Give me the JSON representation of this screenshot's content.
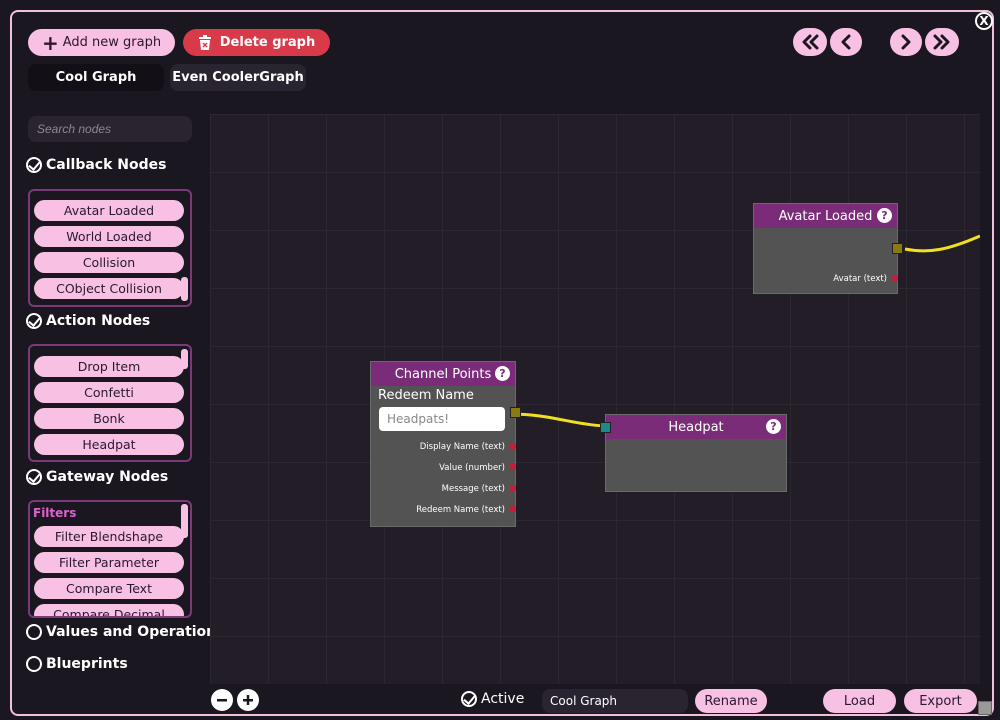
{
  "toolbar": {
    "add_label": "Add new graph",
    "delete_label": "Delete graph"
  },
  "tabs": [
    {
      "label": "Cool Graph"
    },
    {
      "label": "Even CoolerGraph"
    }
  ],
  "window": {
    "close_label": "X"
  },
  "sidebar": {
    "search_placeholder": "Search nodes",
    "callback": {
      "title": "Callback Nodes",
      "items": [
        "Avatar Loaded",
        "World Loaded",
        "Collision",
        "CObject Collision"
      ]
    },
    "action": {
      "title": "Action Nodes",
      "items": [
        "Drop Item",
        "Confetti",
        "Bonk",
        "Headpat"
      ]
    },
    "gateway": {
      "title": "Gateway Nodes",
      "group_label": "Filters",
      "items": [
        "Filter Blendshape",
        "Filter Parameter",
        "Compare Text",
        "Compare Decimal"
      ]
    },
    "values": {
      "title": "Values and Operations"
    },
    "blueprints": {
      "title": "Blueprints"
    }
  },
  "nodes": {
    "avatar_loaded": {
      "title": "Avatar Loaded",
      "output": "Avatar (text)"
    },
    "channel_points": {
      "title": "Channel Points",
      "field_label": "Redeem Name",
      "field_value": "Headpats!",
      "outputs": [
        "Display Name (text)",
        "Value (number)",
        "Message (text)",
        "Redeem Name (text)"
      ]
    },
    "headpat": {
      "title": "Headpat"
    }
  },
  "help_glyph": "?",
  "bottom": {
    "active_label": "Active",
    "graph_name": "Cool Graph",
    "rename_label": "Rename",
    "load_label": "Load",
    "export_label": "Export"
  },
  "colors": {
    "accent_pink": "#f8c0e2",
    "delete_red": "#d93a4a",
    "node_header": "#7a2c78",
    "connection": "#f0e020"
  }
}
